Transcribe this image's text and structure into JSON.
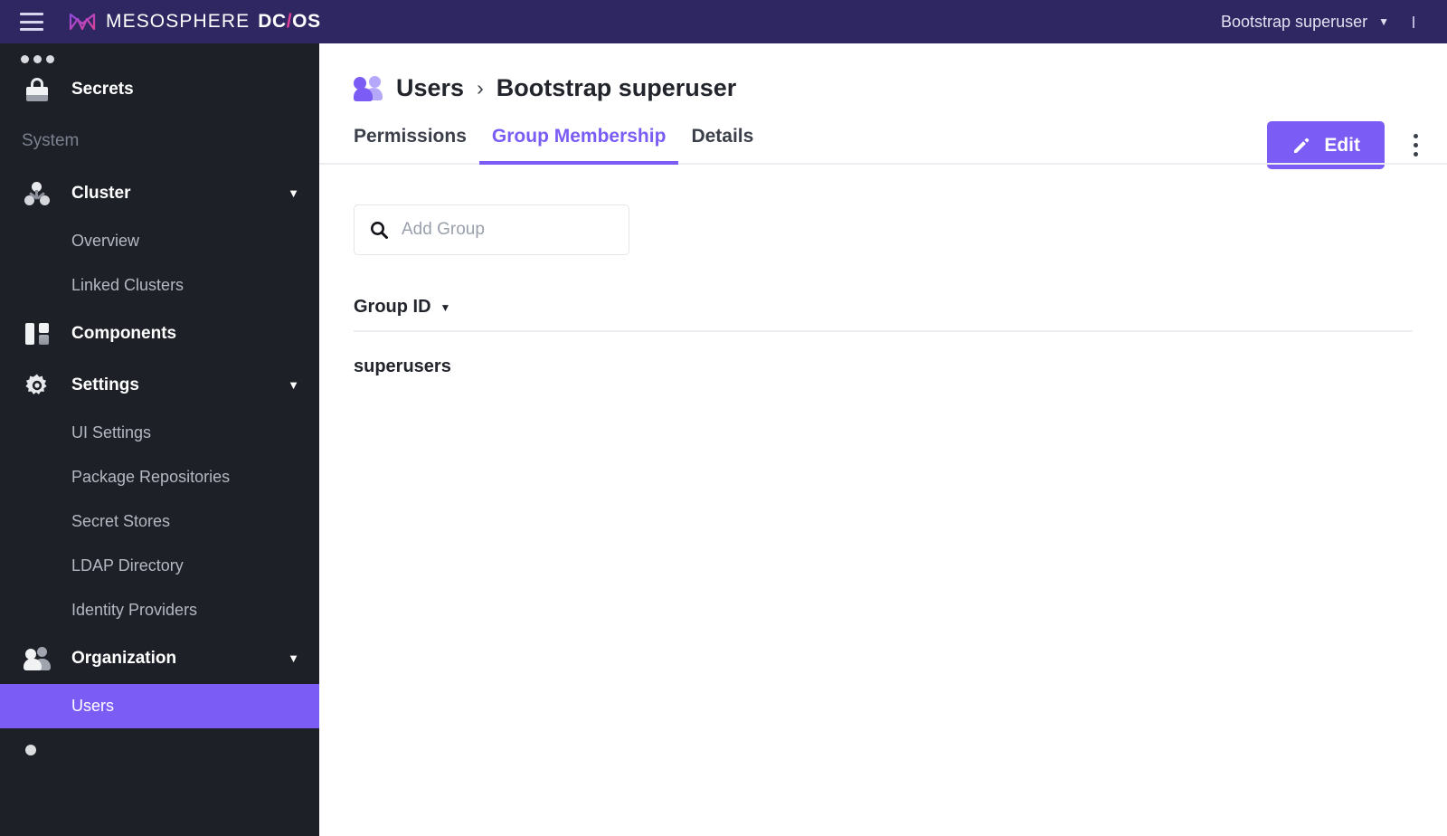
{
  "topbar": {
    "menu_icon": "hamburger-icon",
    "brand_company": "MESOSPHERE",
    "brand_product_left": "DC",
    "brand_product_slash": "/",
    "brand_product_right": "OS",
    "user_name": "Bootstrap superuser",
    "user_caret": "▼"
  },
  "sidebar": {
    "clipped_item": {
      "label": "",
      "icon": "ellipsis-icon"
    },
    "items": [
      {
        "label": "Secrets",
        "icon": "lock-icon",
        "type": "item"
      }
    ],
    "section_label": "System",
    "cluster": {
      "label": "Cluster",
      "icon": "cluster-nodes-icon",
      "chevron": "▼",
      "children": [
        {
          "label": "Overview"
        },
        {
          "label": "Linked Clusters"
        }
      ]
    },
    "components": {
      "label": "Components",
      "icon": "components-panel-icon"
    },
    "settings": {
      "label": "Settings",
      "icon": "gear-icon",
      "chevron": "▼",
      "children": [
        {
          "label": "UI Settings"
        },
        {
          "label": "Package Repositories"
        },
        {
          "label": "Secret Stores"
        },
        {
          "label": "LDAP Directory"
        },
        {
          "label": "Identity Providers"
        }
      ]
    },
    "organization": {
      "label": "Organization",
      "icon": "people-icon",
      "chevron": "▼",
      "children": [
        {
          "label": "Users",
          "active": true
        }
      ]
    },
    "active_color": "#7b5cf5",
    "background_color": "#1d2027"
  },
  "page": {
    "breadcrumb": {
      "icon": "users-icon",
      "parent": "Users",
      "separator": "›",
      "current": "Bootstrap superuser"
    },
    "edit_button": {
      "label": "Edit",
      "icon": "pencil-icon"
    },
    "kebab_menu": "more-options-icon",
    "tabs": [
      {
        "label": "Permissions",
        "active": false
      },
      {
        "label": "Group Membership",
        "active": true
      },
      {
        "label": "Details",
        "active": false
      }
    ],
    "search": {
      "placeholder": "Add Group",
      "value": "",
      "icon": "search-icon"
    },
    "table": {
      "columns": [
        {
          "label": "Group ID",
          "sort": "▼"
        }
      ],
      "rows": [
        {
          "group_id": "superusers"
        }
      ]
    }
  },
  "colors": {
    "header_bg": "#2f2761",
    "sidebar_bg": "#1d2027",
    "accent_purple": "#7b5cf5",
    "brand_pink": "#e0409a",
    "text_dark": "#22252c"
  }
}
